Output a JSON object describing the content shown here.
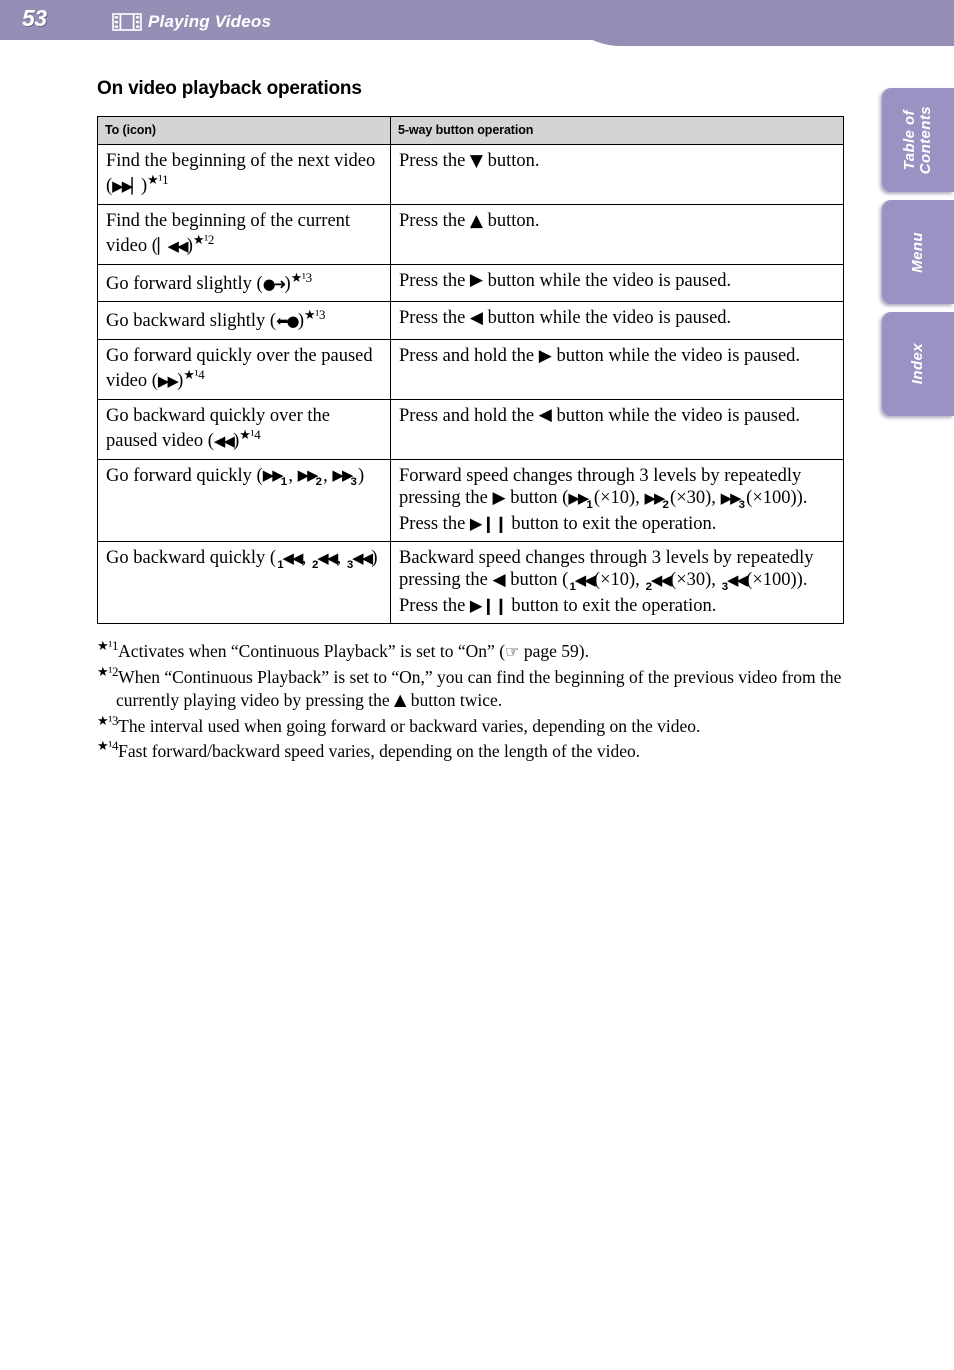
{
  "header": {
    "page_number": "53",
    "icon": "filmstrip-icon",
    "title": "Playing Videos",
    "bar_color": "#948fb5"
  },
  "side_tabs": [
    {
      "id": "table-of-contents",
      "label": "Table of\nContents",
      "color": "#9a92c2"
    },
    {
      "id": "menu",
      "label": "Menu",
      "color": "#9a92c2"
    },
    {
      "id": "index",
      "label": "Index",
      "color": "#9a92c2"
    }
  ],
  "main": {
    "section_title": "On video playback operations",
    "table": {
      "headers": [
        "To (icon)",
        "5-way button operation"
      ],
      "rows": [
        {
          "to_pre": "Find the beginning of the next video (",
          "to_icon": "▶▶▏",
          "to_post": ")",
          "to_footnote": "★¹1",
          "op_pre": "Press the ",
          "op_icon": "▼",
          "op_post": " button."
        },
        {
          "to_pre": "Find the beginning of the current video (",
          "to_icon": "▏◀◀",
          "to_post": ")",
          "to_footnote": "★¹2",
          "op_pre": "Press the ",
          "op_icon": "▲",
          "op_post": " button."
        },
        {
          "to_pre": "Go forward slightly (",
          "to_icon": "●➜",
          "to_post": ")",
          "to_footnote": "★¹3",
          "op_pre": "Press the ",
          "op_icon": "▶",
          "op_post": " button while the video is paused."
        },
        {
          "to_pre": "Go backward slightly (",
          "to_icon": "⬅●",
          "to_post": ")",
          "to_footnote": "★¹3",
          "op_pre": "Press the ",
          "op_icon": "◀",
          "op_post": " button while the video is paused."
        },
        {
          "to_pre": "Go forward quickly over the paused video (",
          "to_icon": "▶▶",
          "to_post": ")",
          "to_footnote": "★¹4",
          "op_pre": "Press and hold the ",
          "op_icon": "▶",
          "op_post": " button while the video is paused."
        },
        {
          "to_pre": "Go backward quickly over the paused video (",
          "to_icon": "◀◀",
          "to_post": ")",
          "to_footnote": "★¹4",
          "op_pre": "Press and hold the ",
          "op_icon": "◀",
          "op_post": " button while the video is paused."
        }
      ],
      "row_forward_quickly": {
        "to_text_1": "Go forward quickly (",
        "to_icon": "▶▶",
        "to_sub_1": "1",
        "to_sep_1": ", ",
        "to_sub_2": "2",
        "to_sep_2": ", ",
        "to_sub_3": "3",
        "to_text_2": ")",
        "op_line1_a": "Forward speed changes through 3 levels by repeatedly pressing the ",
        "op_line1_icon": "▶",
        "op_line1_b": " button (",
        "op_speed_1": "(×10), ",
        "op_speed_2": "(×30), ",
        "op_speed_3": "(×100)).",
        "op_exit_pre": "Press the ",
        "op_exit_icon": "▶❙❙",
        "op_exit_post": " button to exit the operation."
      },
      "row_backward_quickly": {
        "to_text_1": "Go backward quickly (",
        "to_icon": "◀◀",
        "to_sub_1": "1",
        "to_sep_1": ", ",
        "to_sub_2": "2",
        "to_sep_2": ", ",
        "to_sub_3": "3",
        "to_text_2": ")",
        "op_line1_a": "Backward speed changes through 3 levels by repeatedly pressing the ",
        "op_line1_icon": "◀",
        "op_line1_b": " button (",
        "op_speed_1": "(×10), ",
        "op_speed_2": "(×30), ",
        "op_speed_3": "(×100)).",
        "op_exit_pre": "Press the ",
        "op_exit_icon": "▶❙❙",
        "op_exit_post": " button to exit the operation."
      }
    },
    "footnotes": [
      {
        "mark": "★¹1",
        "text_a": "Activates when “Continuous Playback” is set to “On” (",
        "icon": "☞",
        "text_b": " page 59)."
      },
      {
        "mark": "★¹2",
        "text_a": "When “Continuous Playback” is set to “On,” you can find the beginning of the previous video from the currently playing video by pressing the ",
        "icon": "▲",
        "text_b": " button twice."
      },
      {
        "mark": "★¹3",
        "text_a": "The interval used when going forward or backward varies, depending on the video.",
        "icon": "",
        "text_b": ""
      },
      {
        "mark": "★¹4",
        "text_a": "Fast forward/backward speed varies, depending on the length of the video.",
        "icon": "",
        "text_b": ""
      }
    ]
  }
}
